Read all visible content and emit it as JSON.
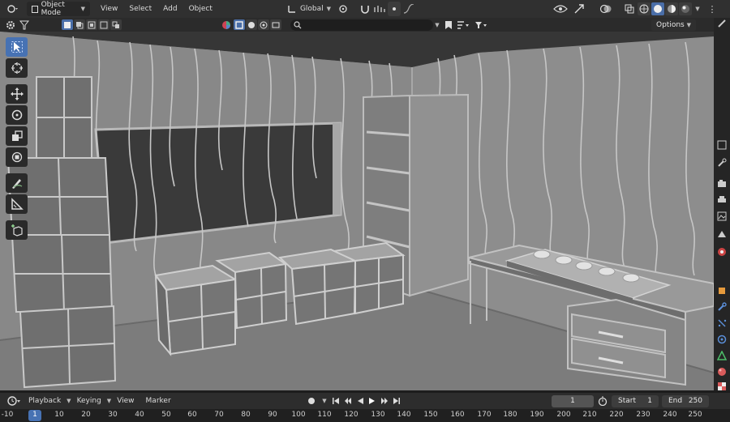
{
  "header": {
    "editor_type_icon": "view3d-icon",
    "mode": "Object Mode",
    "menus": [
      "View",
      "Select",
      "Add",
      "Object"
    ],
    "transform_orientation": "Global",
    "overlays_icon": "overlays-icon",
    "gizmo_icon": "gizmo-icon"
  },
  "subheader": {
    "options_label": "Options",
    "search_placeholder": ""
  },
  "viewport": {
    "shading_mode": "solid",
    "background": "#7f7f7f"
  },
  "toolbar": {
    "tools": [
      "select-box",
      "cursor",
      "move",
      "rotate",
      "scale",
      "transform",
      "annotate",
      "measure",
      "add-cube"
    ],
    "active": "select-box"
  },
  "timeline": {
    "menus": [
      "Playback",
      "Keying",
      "View",
      "Marker"
    ],
    "current_frame": "1",
    "start_label": "Start",
    "start_value": "1",
    "end_label": "End",
    "end_value": "250",
    "ruler_labels": [
      "-10",
      "1",
      "10",
      "20",
      "30",
      "40",
      "50",
      "60",
      "70",
      "80",
      "90",
      "100",
      "110",
      "120",
      "130",
      "140",
      "150",
      "160",
      "170",
      "180",
      "190",
      "200",
      "210",
      "220",
      "230",
      "240",
      "250"
    ],
    "current_ruler_label": "1"
  },
  "colors": {
    "accent": "#4772b3",
    "header_bg": "#303030",
    "panel_bg": "#2b2b2b"
  }
}
